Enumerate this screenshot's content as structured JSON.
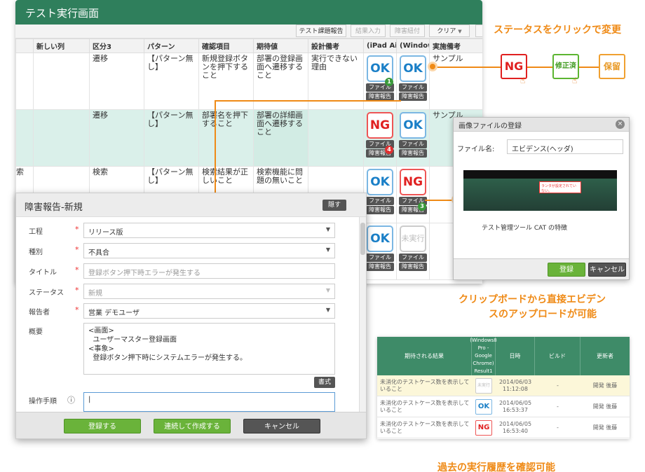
{
  "main": {
    "title": "テスト実行画面",
    "toolbar": {
      "report": "テスト課題報告",
      "result_input": "結果入力",
      "bug_link": "障害紐付",
      "clear": "クリア"
    },
    "columns": [
      "",
      "新しい列",
      "区分3",
      "パターン",
      "確認項目",
      "期待値",
      "設計備考",
      "(iPad Air",
      "(Window",
      "実施備考"
    ],
    "rows": [
      {
        "division": "遷移",
        "pattern": "【パターン無し】",
        "check": "新規登録ボタンを押下すること",
        "expected": "部署の登録画面へ遷移すること",
        "design_note": "実行できない理由",
        "status1": "OK",
        "status2": "OK",
        "note": "サンプル"
      },
      {
        "division": "遷移",
        "pattern": "【パターン無し】",
        "check": "部署名を押下すること",
        "expected": "部署の詳細画面へ遷移すること",
        "design_note": "",
        "status1": "NG",
        "status2": "OK",
        "note": "サンプル"
      },
      {
        "division": "検索",
        "pattern": "【パターン無し】",
        "check": "検索結果が正しいこと",
        "expected": "検索機能に問題の無いこと",
        "design_note": "",
        "status1": "OK",
        "status2": "NG",
        "note": ""
      },
      {
        "status1": "OK",
        "status2": "未実行"
      }
    ],
    "left_edge_char": "索",
    "file_label": "ファイル",
    "bug_report_label": "障害報告",
    "badges": [
      "1",
      "4",
      "3"
    ]
  },
  "bug_dialog": {
    "title": "障害報告-新規",
    "hide": "隠す",
    "fields": [
      {
        "label": "工程",
        "required": true,
        "value": "リリース版"
      },
      {
        "label": "種別",
        "required": true,
        "value": "不具合"
      },
      {
        "label": "タイトル",
        "required": true,
        "value": "登録ボタン押下時エラーが発生する"
      },
      {
        "label": "ステータス",
        "required": true,
        "value": "新規"
      },
      {
        "label": "報告者",
        "required": true,
        "value": "営業 デモユーザ"
      }
    ],
    "summary_label": "概要",
    "summary_text": "<画面>\n  ユーザーマスター登録画面\n<事象>\n  登録ボタン押下時にシステムエラーが発生する。",
    "format_button": "書式",
    "steps_label": "操作手順",
    "register": "登録する",
    "register_continue": "連続して作成する",
    "cancel": "キャンセル"
  },
  "status_flow": {
    "title": "ステータスをクリックで変更",
    "ng": "NG",
    "fixed": "修正済",
    "hold": "保留",
    "colors": {
      "ng": "#e02020",
      "fixed": "#5cb531",
      "hold": "#f0a030",
      "accent": "#ef8a16"
    }
  },
  "image_dialog": {
    "title": "画像ファイルの登録",
    "filename_label": "ファイル名:",
    "filename_value": "エビデンス(ヘッダ)",
    "preview_caption": "テスト管理ツール CAT の特徴",
    "preview_popup": "ランタが設定されていない。",
    "register": "登録",
    "cancel": "キャンセル"
  },
  "clipboard_caption_line1": "クリップボードから直接エビデン",
  "clipboard_caption_line2": "スのアップロードが可能",
  "history": {
    "headers": [
      "期待される結果",
      "(Windows8 Pro - Google Chrome) Result1",
      "日時",
      "ビルド",
      "更新者"
    ],
    "rows": [
      {
        "expected": "未消化のテストケース数を表示していること",
        "status": "未実行",
        "date": "2014/06/03",
        "time": "11:12:08",
        "build": "-",
        "updater": "開発 後藤"
      },
      {
        "expected": "未消化のテストケース数を表示していること",
        "status": "OK",
        "date": "2014/06/05",
        "time": "16:53:37",
        "build": "-",
        "updater": "開発 後藤"
      },
      {
        "expected": "未消化のテストケース数を表示していること",
        "status": "NG",
        "date": "2014/06/05",
        "time": "16:53:40",
        "build": "-",
        "updater": "開発 後藤"
      }
    ]
  },
  "history_caption": "過去の実行履歴を確認可能"
}
